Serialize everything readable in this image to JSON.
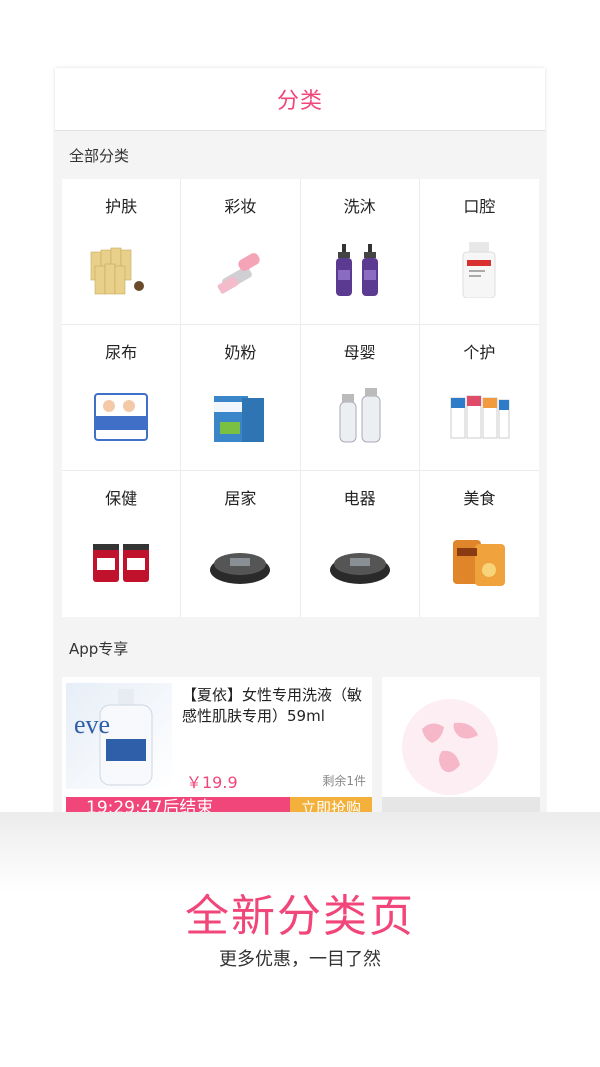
{
  "header": {
    "title": "分类"
  },
  "sections": {
    "all_categories": "全部分类",
    "app_exclusive": "App专享"
  },
  "categories": [
    {
      "label": "护肤",
      "icon": "skincare-icon"
    },
    {
      "label": "彩妆",
      "icon": "lipstick-icon"
    },
    {
      "label": "洗沐",
      "icon": "body-wash-icon"
    },
    {
      "label": "口腔",
      "icon": "mouthwash-icon"
    },
    {
      "label": "尿布",
      "icon": "diaper-icon"
    },
    {
      "label": "奶粉",
      "icon": "milk-powder-icon"
    },
    {
      "label": "母婴",
      "icon": "baby-bottle-icon"
    },
    {
      "label": "个护",
      "icon": "toothpaste-icon"
    },
    {
      "label": "保健",
      "icon": "supplement-icon"
    },
    {
      "label": "居家",
      "icon": "robot-vacuum-icon"
    },
    {
      "label": "电器",
      "icon": "robot-vacuum-icon"
    },
    {
      "label": "美食",
      "icon": "snack-bag-icon"
    }
  ],
  "deal": {
    "title": "【夏依】女性专用洗液（敏感性肌肤专用）59ml",
    "price": "￥19.9",
    "stock": "剩余1件",
    "timer": "19:29:47后结束",
    "buy_label": "立即抢购"
  },
  "promo": {
    "headline": "全新分类页",
    "subline": "更多优惠，一目了然"
  },
  "colors": {
    "accent": "#f0467a",
    "buy": "#f3b13c"
  }
}
